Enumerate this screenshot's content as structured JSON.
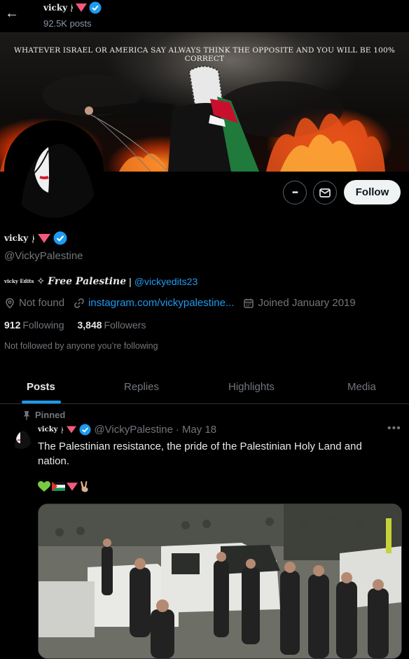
{
  "header": {
    "back_label": "←",
    "display_name": "vicky",
    "posts_count": "92.5K posts"
  },
  "banner": {
    "caption": "WHATEVER ISRAEL OR AMERICA SAY ALWAYS THINK THE OPPOSITE AND YOU WILL BE 100% CORRECT"
  },
  "actions": {
    "more_label": "•••",
    "follow_label": "Follow"
  },
  "profile": {
    "display_name": "vicky",
    "handle": "@VickyPalestine",
    "bio_prefix": "vicky Edits",
    "bio_star": "✧",
    "bio_text": "Free Palestine",
    "bio_sep": "|",
    "bio_link": "@vickyedits23",
    "location": "Not found",
    "website": "instagram.com/vickypalestine...",
    "joined": "Joined January 2019",
    "following_count": "912",
    "following_label": "Following",
    "followers_count": "3,848",
    "followers_label": "Followers",
    "not_followed": "Not followed by anyone you’re following"
  },
  "tabs": [
    {
      "label": "Posts"
    },
    {
      "label": "Replies"
    },
    {
      "label": "Highlights"
    },
    {
      "label": "Media"
    }
  ],
  "post": {
    "pinned_label": "Pinned",
    "author_name": "vicky",
    "author_handle": "@VickyPalestine",
    "dot": "·",
    "date": "May 18",
    "more": "•••",
    "text": "The Palestinian resistance, the pride of the Palestinian Holy Land and nation.",
    "emoji": [
      "💚",
      "🇵🇸",
      "🔻",
      "✌🏼"
    ]
  },
  "colors": {
    "accent": "#1d9bf0",
    "verified": "#1d9bf0",
    "triangle": "#f4597c",
    "muted": "#71767b",
    "background": "#000000"
  }
}
